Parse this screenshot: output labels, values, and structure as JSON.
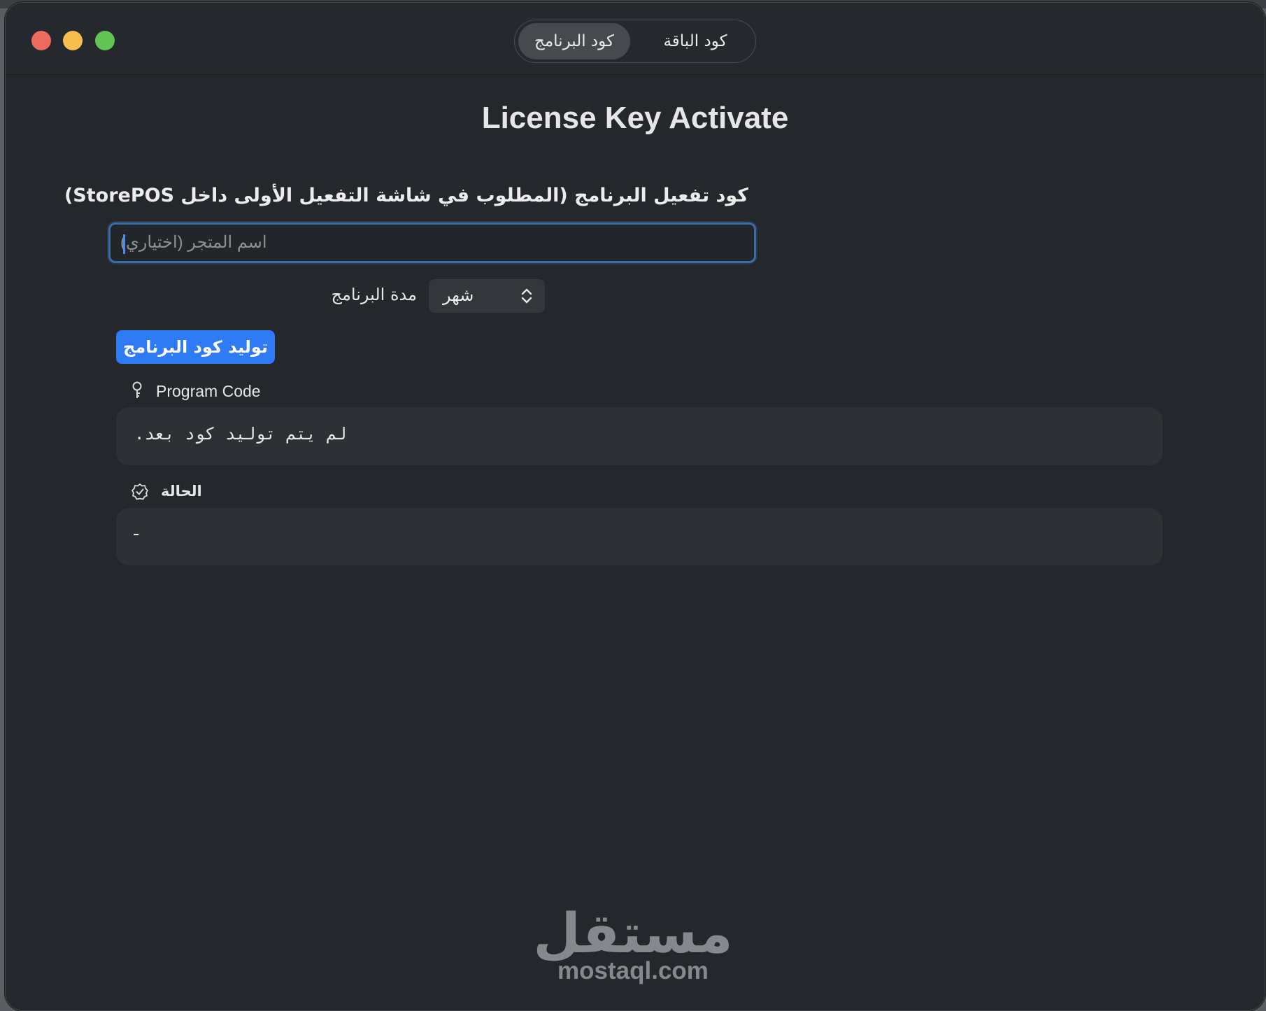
{
  "window": {
    "tabs": [
      {
        "label": "كود البرنامج",
        "selected": true
      },
      {
        "label": "كود الباقة",
        "selected": false
      }
    ]
  },
  "main": {
    "heading": "License Key Activate",
    "section_title": "كود تفعيل البرنامج (المطلوب في شاشة التفعيل الأولى داخل StorePOS)",
    "store_name": {
      "placeholder": "اسم المتجر (اختياري)",
      "value": ""
    },
    "duration": {
      "label": "مدة البرنامج",
      "selected": "شهر"
    },
    "generate_button": "توليد كود البرنامج",
    "program_code": {
      "label": "Program Code",
      "value": "لم يتم توليد كود بعد."
    },
    "status": {
      "label": "الحالة",
      "value": "-"
    }
  },
  "watermark": {
    "arabic": "مستقل",
    "latin": "mostaql.com"
  },
  "colors": {
    "accent": "#2f7bf5",
    "focus_ring": "#3c6ca6",
    "window_bg": "#24272b",
    "panel_bg": "#2d3034"
  },
  "icons": {
    "close": "traffic-red-circle",
    "minimize": "traffic-yellow-circle",
    "zoom": "traffic-green-circle",
    "program_code": "key-icon",
    "status": "checkmark-seal-icon",
    "select": "chevron-up-down-icon"
  }
}
